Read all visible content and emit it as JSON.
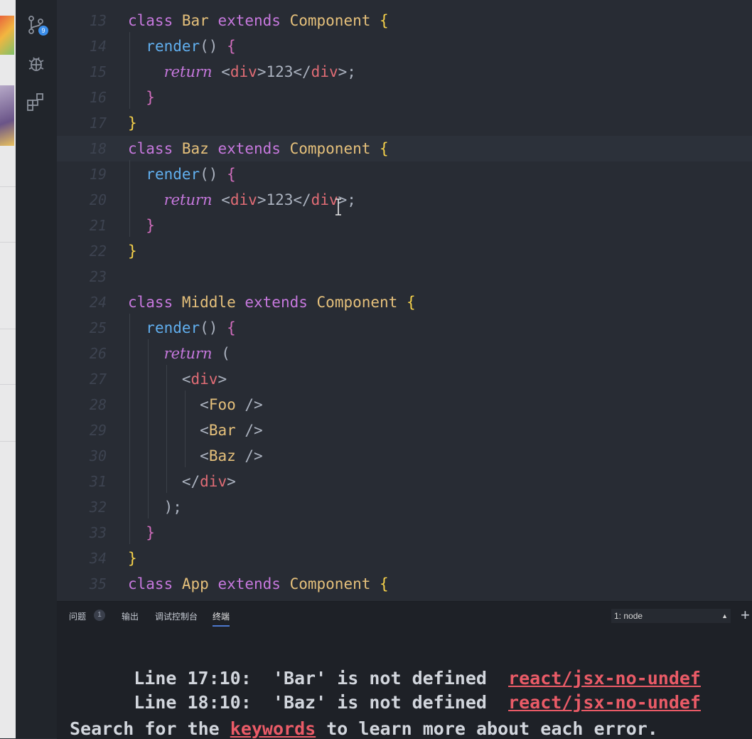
{
  "source_control_badge": "9",
  "code_lines": [
    {
      "num": "13",
      "tokens": [
        [
          "class ",
          "kw"
        ],
        [
          "Bar ",
          "cls"
        ],
        [
          "extends ",
          "kw"
        ],
        [
          "Component ",
          "cls"
        ],
        [
          "{",
          "brace-y"
        ]
      ]
    },
    {
      "num": "14",
      "tokens": [
        [
          "  "
        ],
        [
          "render",
          "fn"
        ],
        [
          "() ",
          "pn"
        ],
        [
          "{",
          "brace-p"
        ]
      ]
    },
    {
      "num": "15",
      "tokens": [
        [
          "    "
        ],
        [
          "return",
          "ret"
        ],
        [
          " <",
          "pn"
        ],
        [
          "div",
          "tag"
        ],
        [
          ">123</",
          "pn"
        ],
        [
          "div",
          "tag"
        ],
        [
          ">;",
          "pn"
        ]
      ]
    },
    {
      "num": "16",
      "tokens": [
        [
          "  "
        ],
        [
          "}",
          "brace-p"
        ]
      ]
    },
    {
      "num": "17",
      "tokens": [
        [
          "}",
          "brace-y"
        ]
      ]
    },
    {
      "num": "18",
      "tokens": [
        [
          "class ",
          "kw"
        ],
        [
          "Baz ",
          "cls"
        ],
        [
          "extends ",
          "kw"
        ],
        [
          "Component ",
          "cls"
        ],
        [
          "{",
          "brace-y"
        ]
      ]
    },
    {
      "num": "19",
      "tokens": [
        [
          "  "
        ],
        [
          "render",
          "fn"
        ],
        [
          "() ",
          "pn"
        ],
        [
          "{",
          "brace-p"
        ]
      ]
    },
    {
      "num": "20",
      "tokens": [
        [
          "    "
        ],
        [
          "return",
          "ret"
        ],
        [
          " <",
          "pn"
        ],
        [
          "div",
          "tag"
        ],
        [
          ">123</",
          "pn"
        ],
        [
          "div",
          "tag"
        ],
        [
          ">;",
          "pn"
        ]
      ]
    },
    {
      "num": "21",
      "tokens": [
        [
          "  "
        ],
        [
          "}",
          "brace-p"
        ]
      ]
    },
    {
      "num": "22",
      "tokens": [
        [
          "}",
          "brace-y"
        ]
      ]
    },
    {
      "num": "23",
      "tokens": []
    },
    {
      "num": "24",
      "tokens": [
        [
          "class ",
          "kw"
        ],
        [
          "Middle ",
          "cls"
        ],
        [
          "extends ",
          "kw"
        ],
        [
          "Component ",
          "cls"
        ],
        [
          "{",
          "brace-y"
        ]
      ]
    },
    {
      "num": "25",
      "tokens": [
        [
          "  "
        ],
        [
          "render",
          "fn"
        ],
        [
          "() ",
          "pn"
        ],
        [
          "{",
          "brace-p"
        ]
      ]
    },
    {
      "num": "26",
      "tokens": [
        [
          "    "
        ],
        [
          "return",
          "ret"
        ],
        [
          " (",
          "pn"
        ]
      ]
    },
    {
      "num": "27",
      "tokens": [
        [
          "      "
        ],
        [
          "<",
          "pn"
        ],
        [
          "div",
          "tag"
        ],
        [
          ">",
          "pn"
        ]
      ]
    },
    {
      "num": "28",
      "tokens": [
        [
          "        "
        ],
        [
          "<",
          "pn"
        ],
        [
          "Foo ",
          "cls"
        ],
        [
          "/>",
          "pn"
        ]
      ]
    },
    {
      "num": "29",
      "tokens": [
        [
          "        "
        ],
        [
          "<",
          "pn"
        ],
        [
          "Bar ",
          "cls"
        ],
        [
          "/>",
          "pn"
        ]
      ]
    },
    {
      "num": "30",
      "tokens": [
        [
          "        "
        ],
        [
          "<",
          "pn"
        ],
        [
          "Baz ",
          "cls"
        ],
        [
          "/>",
          "pn"
        ]
      ]
    },
    {
      "num": "31",
      "tokens": [
        [
          "      "
        ],
        [
          "</",
          "pn"
        ],
        [
          "div",
          "tag"
        ],
        [
          ">",
          "pn"
        ]
      ]
    },
    {
      "num": "32",
      "tokens": [
        [
          "    "
        ],
        [
          ");",
          "pn"
        ]
      ]
    },
    {
      "num": "33",
      "tokens": [
        [
          "  "
        ],
        [
          "}",
          "brace-p"
        ]
      ]
    },
    {
      "num": "34",
      "tokens": [
        [
          "}",
          "brace-y"
        ]
      ]
    },
    {
      "num": "35",
      "tokens": [
        [
          "class ",
          "kw"
        ],
        [
          "App ",
          "cls"
        ],
        [
          "extends ",
          "kw"
        ],
        [
          "Component ",
          "cls"
        ],
        [
          "{",
          "brace-y"
        ]
      ]
    }
  ],
  "current_line": "18",
  "panel": {
    "tabs": [
      {
        "label": "问题",
        "active": false
      },
      {
        "label": "输出",
        "active": false
      },
      {
        "label": "调试控制台",
        "active": false
      },
      {
        "label": "终端",
        "active": true
      }
    ],
    "problems_count": "1",
    "terminal_select": "1: node",
    "add_label": "+"
  },
  "terminal": {
    "errors": [
      {
        "loc": "Line 17:10:",
        "msg": "'Bar' is not defined",
        "rule": "react/jsx-no-undef"
      },
      {
        "loc": "Line 18:10:",
        "msg": "'Baz' is not defined",
        "rule": "react/jsx-no-undef"
      }
    ],
    "hint_before": "Search for the ",
    "hint_link": "keywords",
    "hint_after": " to learn more about each error."
  }
}
